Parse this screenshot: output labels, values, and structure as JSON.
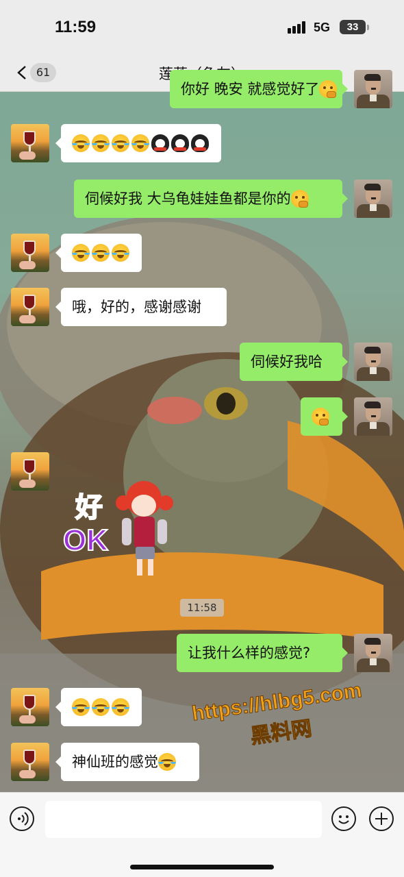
{
  "status_bar": {
    "time": "11:59",
    "network": "5G",
    "battery": "33"
  },
  "header": {
    "back_badge": "61",
    "title": "莲莲（龟友）"
  },
  "messages": [
    {
      "side": "out",
      "text": "你好 晚安 就感觉好了",
      "emoji": "think",
      "partial": true
    },
    {
      "side": "in",
      "text": "",
      "emojis": [
        "cry",
        "cry",
        "cry",
        "cry",
        "penguin",
        "penguin",
        "penguin"
      ]
    },
    {
      "side": "out",
      "text": "伺候好我 大乌龟娃娃鱼都是你的",
      "emoji": "think"
    },
    {
      "side": "in",
      "text": "",
      "emojis": [
        "cry",
        "cry",
        "cry"
      ]
    },
    {
      "side": "in",
      "text": "哦，好的，感谢感谢"
    },
    {
      "side": "out",
      "text": "伺候好我哈"
    },
    {
      "side": "out",
      "text": "",
      "emoji": "think"
    },
    {
      "side": "in",
      "type": "sticker",
      "sticker_text_top": "好",
      "sticker_text_bottom": "OK"
    },
    {
      "side": "out",
      "text": "让我什么样的感觉?"
    },
    {
      "side": "in",
      "text": "",
      "emojis": [
        "cry",
        "cry",
        "cry"
      ]
    },
    {
      "side": "in",
      "text": "神仙班的感觉",
      "emoji": "cry"
    }
  ],
  "timestamp": "11:58",
  "watermark": {
    "url": "https://hlbg5.com",
    "name": "黑料网"
  },
  "input_bar": {
    "placeholder": ""
  }
}
